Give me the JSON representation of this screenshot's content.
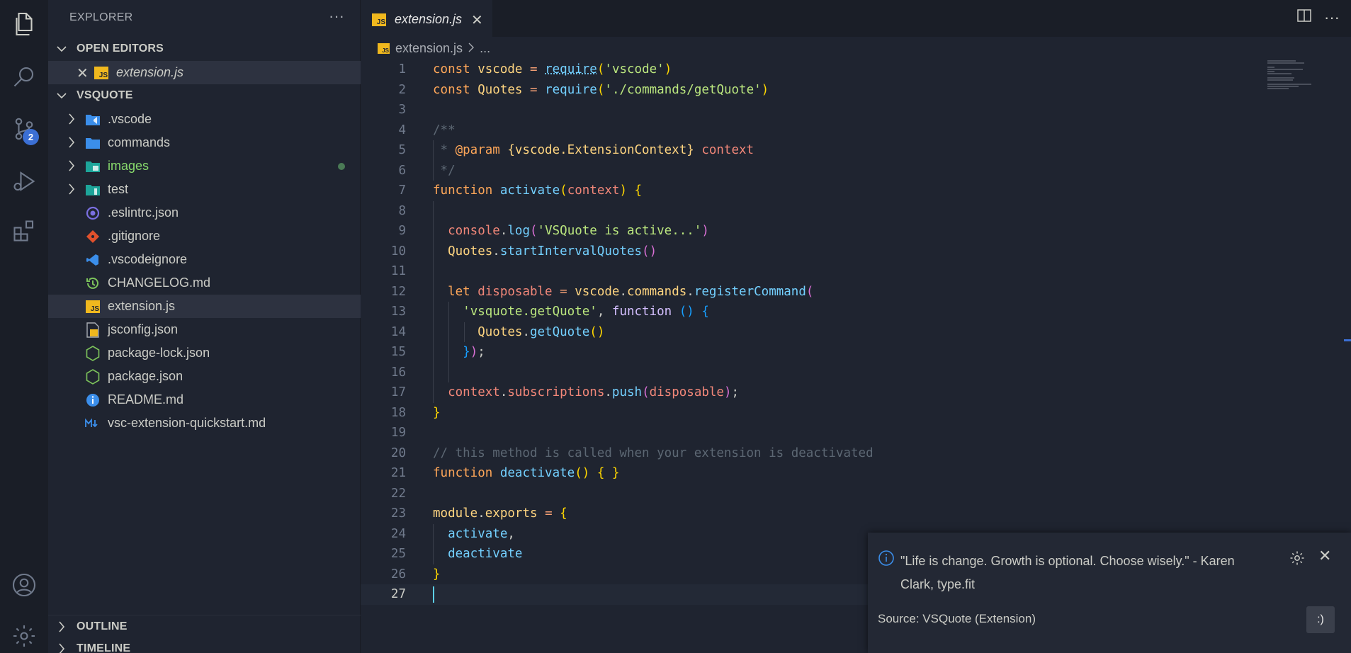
{
  "activitybar": {
    "icons": [
      "files-icon",
      "search-icon",
      "source-control-icon",
      "run-debug-icon",
      "extensions-icon",
      "account-icon",
      "settings-gear-icon"
    ],
    "scm_badge": "2"
  },
  "sidebar": {
    "title": "EXPLORER",
    "more": "···",
    "open_editors_label": "OPEN EDITORS",
    "open_editors": [
      {
        "name": "extension.js"
      }
    ],
    "project_label": "VSQUOTE",
    "files": [
      {
        "name": ".vscode",
        "type": "folder"
      },
      {
        "name": "commands",
        "type": "folder"
      },
      {
        "name": "images",
        "type": "folder"
      },
      {
        "name": "test",
        "type": "folder"
      },
      {
        "name": ".eslintrc.json",
        "type": "file"
      },
      {
        "name": ".gitignore",
        "type": "file"
      },
      {
        "name": ".vscodeignore",
        "type": "file"
      },
      {
        "name": "CHANGELOG.md",
        "type": "file"
      },
      {
        "name": "extension.js",
        "type": "file"
      },
      {
        "name": "jsconfig.json",
        "type": "file"
      },
      {
        "name": "package-lock.json",
        "type": "file"
      },
      {
        "name": "package.json",
        "type": "file"
      },
      {
        "name": "README.md",
        "type": "file"
      },
      {
        "name": "vsc-extension-quickstart.md",
        "type": "file"
      }
    ],
    "outline_label": "OUTLINE",
    "timeline_label": "TIMELINE"
  },
  "editor": {
    "tab_label": "extension.js",
    "js_badge": "JS",
    "breadcrumb_file": "extension.js",
    "breadcrumb_more": "...",
    "line_numbers": [
      "1",
      "2",
      "3",
      "4",
      "5",
      "6",
      "7",
      "8",
      "9",
      "10",
      "11",
      "12",
      "13",
      "14",
      "15",
      "16",
      "17",
      "18",
      "19",
      "20",
      "21",
      "22",
      "23",
      "24",
      "25",
      "26",
      "27"
    ]
  },
  "notification": {
    "message": "\"Life is change. Growth is optional. Choose wisely.\" - Karen Clark, type.fit",
    "source": "Source: VSQuote (Extension)",
    "button_label": ":)"
  }
}
